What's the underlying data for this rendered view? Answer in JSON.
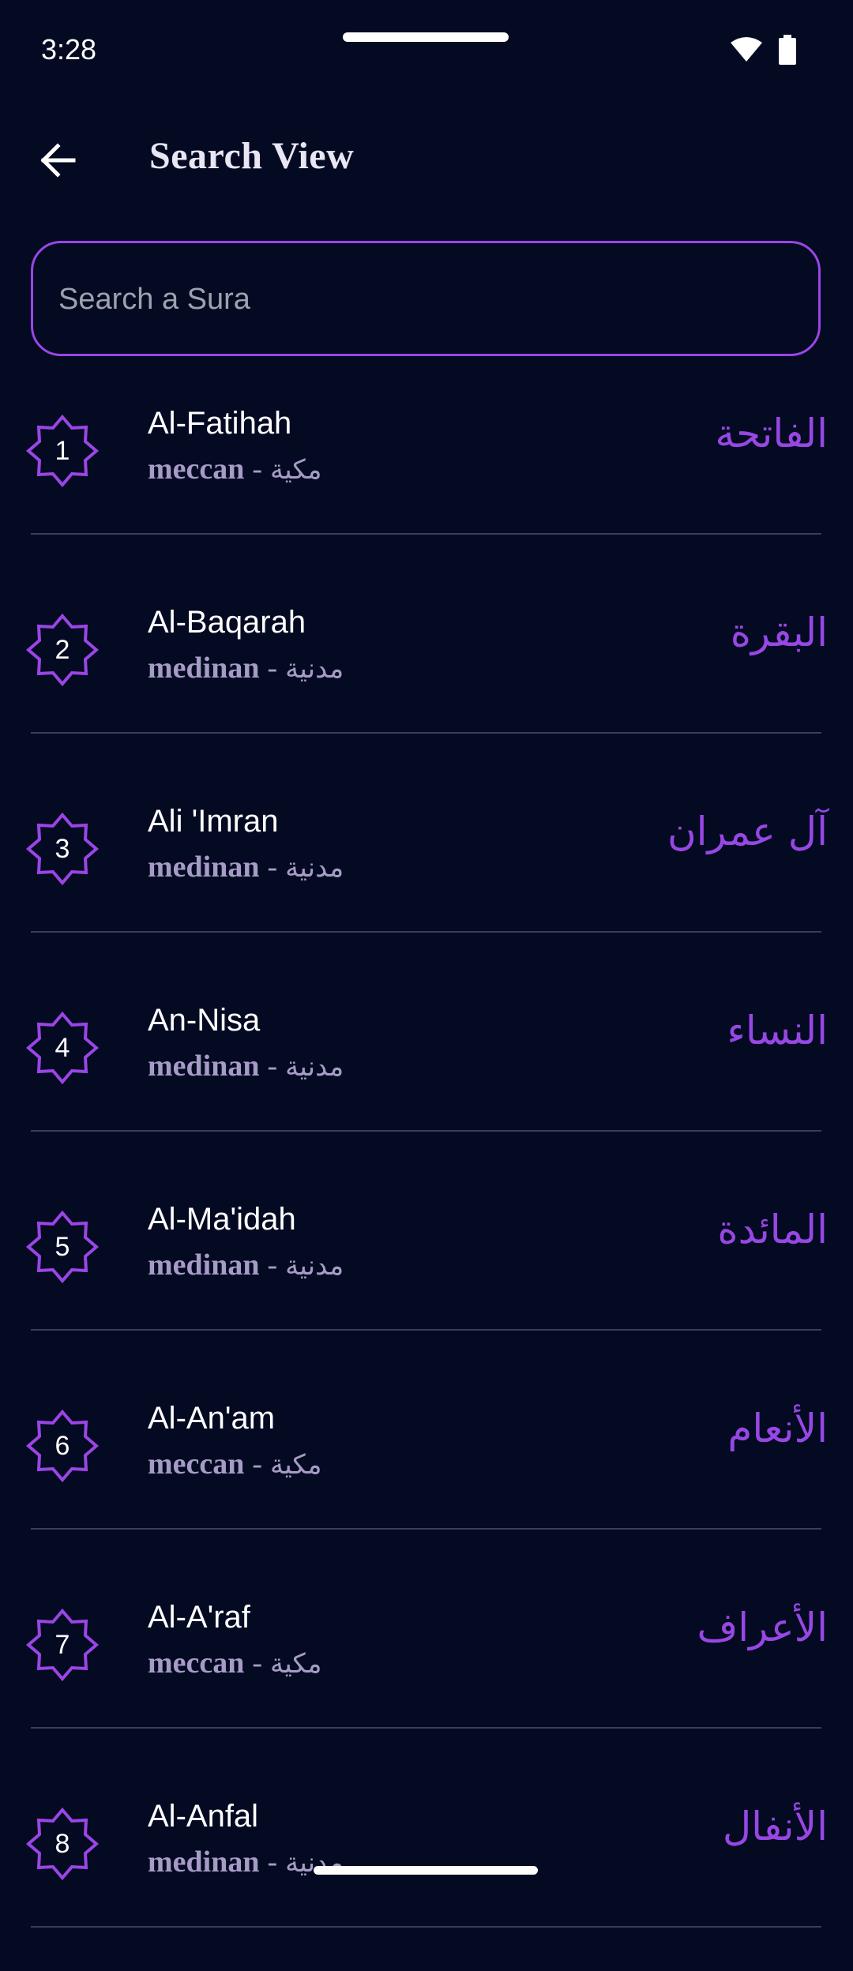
{
  "status_bar": {
    "time": "3:28",
    "icons": [
      "wifi-icon",
      "battery-icon"
    ]
  },
  "app_bar": {
    "back_icon": "arrow-left-icon",
    "title": "Search View"
  },
  "search": {
    "placeholder": "Search a Sura",
    "value": ""
  },
  "colors": {
    "background": "#040a22",
    "accent": "#9b45e6",
    "arabic_text": "#9747e4",
    "meta_text": "#a69bc6",
    "divider": "#3a3f57"
  },
  "suras": [
    {
      "number": "1",
      "name": "Al-Fatihah",
      "type_en": "meccan",
      "separator": "-",
      "type_ar": "مكية",
      "arabic": "الفاتحة"
    },
    {
      "number": "2",
      "name": "Al-Baqarah",
      "type_en": "medinan",
      "separator": "-",
      "type_ar": "مدنية",
      "arabic": "البقرة"
    },
    {
      "number": "3",
      "name": "Ali 'Imran",
      "type_en": "medinan",
      "separator": "-",
      "type_ar": "مدنية",
      "arabic": "آل عمران"
    },
    {
      "number": "4",
      "name": "An-Nisa",
      "type_en": "medinan",
      "separator": "-",
      "type_ar": "مدنية",
      "arabic": "النساء"
    },
    {
      "number": "5",
      "name": "Al-Ma'idah",
      "type_en": "medinan",
      "separator": "-",
      "type_ar": "مدنية",
      "arabic": "المائدة"
    },
    {
      "number": "6",
      "name": "Al-An'am",
      "type_en": "meccan",
      "separator": "-",
      "type_ar": "مكية",
      "arabic": "الأنعام"
    },
    {
      "number": "7",
      "name": "Al-A'raf",
      "type_en": "meccan",
      "separator": "-",
      "type_ar": "مكية",
      "arabic": "الأعراف"
    },
    {
      "number": "8",
      "name": "Al-Anfal",
      "type_en": "medinan",
      "separator": "-",
      "type_ar": "مدنية",
      "arabic": "الأنفال"
    }
  ]
}
